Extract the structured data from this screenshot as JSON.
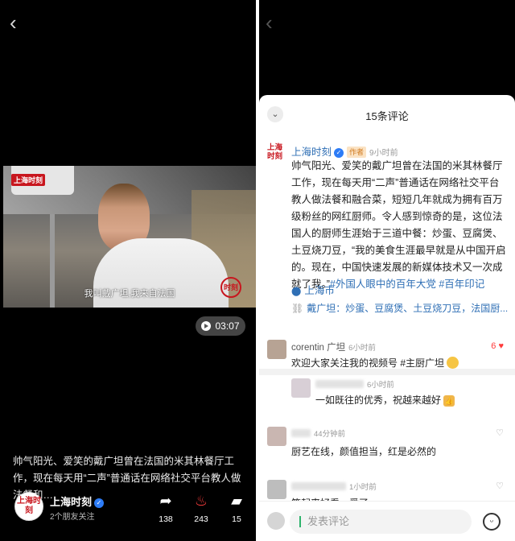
{
  "left": {
    "video": {
      "logo": "上海时刻",
      "subtitle": "我叫戴广坦,我来自法国",
      "seal": "时刻",
      "duration": "03:07"
    },
    "description": "帅气阳光、爱笑的戴广坦曾在法国的米其林餐厅工作，现在每天用“二声”普通话在网络社交平台教人做法餐和…",
    "author": {
      "avatar_text": "上海时刻",
      "name": "上海时刻",
      "sub": "2个朋友关注"
    },
    "actions": {
      "share_count": "138",
      "fire_count": "243",
      "comment_count": "15"
    },
    "icons": {
      "back": "back-arrow-icon",
      "play": "play-icon",
      "share": "share-icon",
      "fire": "fire-icon",
      "comment": "comment-icon",
      "verify": "verified-icon"
    }
  },
  "right": {
    "sheet_title": "15条评论",
    "post": {
      "avatar_text": "上海时刻",
      "name": "上海时刻",
      "author_tag": "作者",
      "time": "9小时前",
      "text": "帅气阳光、爱笑的戴广坦曾在法国的米其林餐厅工作，现在每天用“二声”普通话在网络社交平台教人做法餐和融合菜，短短几年就成为拥有百万级粉丝的网红厨师。令人感到惊奇的是，这位法国人的厨师生涯始于三道中餐：炒蛋、豆腐煲、土豆烧刀豆，“我的美食生涯最早就是从中国开启的。现在，中国快速发展的新媒体技术又一次成就了我。”",
      "tags": "#外国人眼中的百年大党 #百年印记",
      "location": "上海市",
      "topic": "戴广坦：炒蛋、豆腐煲、土豆烧刀豆，法国厨..."
    },
    "comments": [
      {
        "name": "corentin 广坦",
        "time": "6小时前",
        "text": "欢迎大家关注我的视频号 #主厨广坦",
        "likes": "6"
      },
      {
        "name": "",
        "time": "6小时前",
        "text": "一如既往的优秀，祝越来越好"
      },
      {
        "name": "",
        "time": "44分钟前",
        "text": "厨艺在线，颜值担当，红是必然的"
      },
      {
        "name": "",
        "time": "1小时前",
        "text": "笑起来好看，爱了"
      }
    ],
    "input": {
      "placeholder": "发表评论"
    },
    "colors": {
      "link": "#2f6fb5",
      "like_active": "#ff3b3b",
      "brand_red": "#c8161e"
    }
  }
}
